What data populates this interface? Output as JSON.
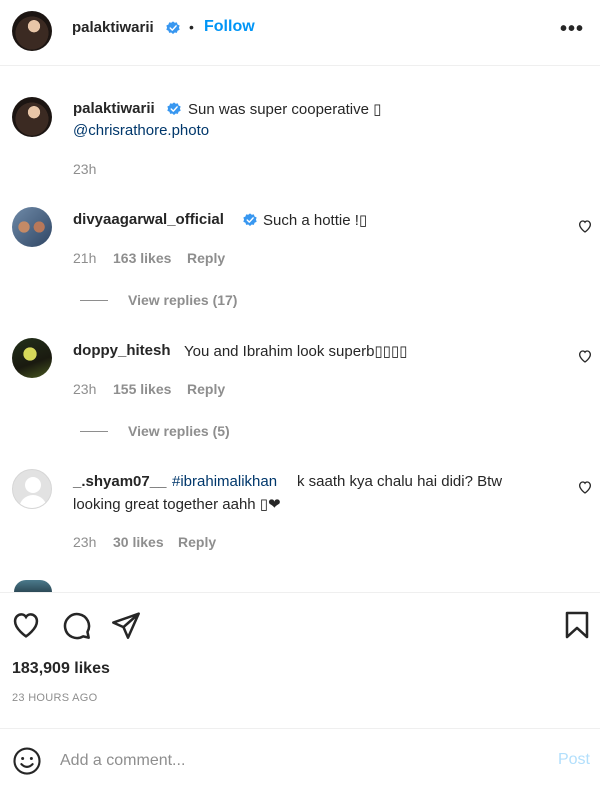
{
  "header": {
    "username": "palaktiwarii",
    "separator": "•",
    "follow_label": "Follow",
    "more_label": "•••"
  },
  "caption": {
    "username": "palaktiwarii",
    "text": "Sun was super cooperative ▯",
    "mention": "@chrisrathore.photo",
    "time": "23h"
  },
  "comments": [
    {
      "username": "divyaagarwal_official",
      "verified": true,
      "text": "Such a hottie !▯",
      "time": "21h",
      "likes": "163 likes",
      "reply": "Reply",
      "view_replies": "View replies (17)"
    },
    {
      "username": "doppy_hitesh",
      "verified": false,
      "text": "You and Ibrahim look superb▯▯▯▯",
      "time": "23h",
      "likes": "155 likes",
      "reply": "Reply",
      "view_replies": "View replies (5)"
    },
    {
      "username": "_.shyam07__",
      "verified": false,
      "hashtag": "#ibrahimalikhan",
      "text_line1": " k saath kya chalu hai didi? Btw",
      "text_line2": "looking great together aahh ▯❤",
      "time": "23h",
      "likes": "30 likes",
      "reply": "Reply"
    }
  ],
  "actions": {
    "icons": [
      "heart-icon",
      "comment-icon",
      "share-icon",
      "bookmark-icon"
    ]
  },
  "likes_count": "183,909 likes",
  "time_ago": "23 HOURS AGO",
  "comment_box": {
    "placeholder": "Add a comment...",
    "post_label": "Post"
  },
  "colors": {
    "link": "#0095f6",
    "mention": "#00376b",
    "muted": "#8e8e8e",
    "post_disabled": "#b2dffc"
  }
}
